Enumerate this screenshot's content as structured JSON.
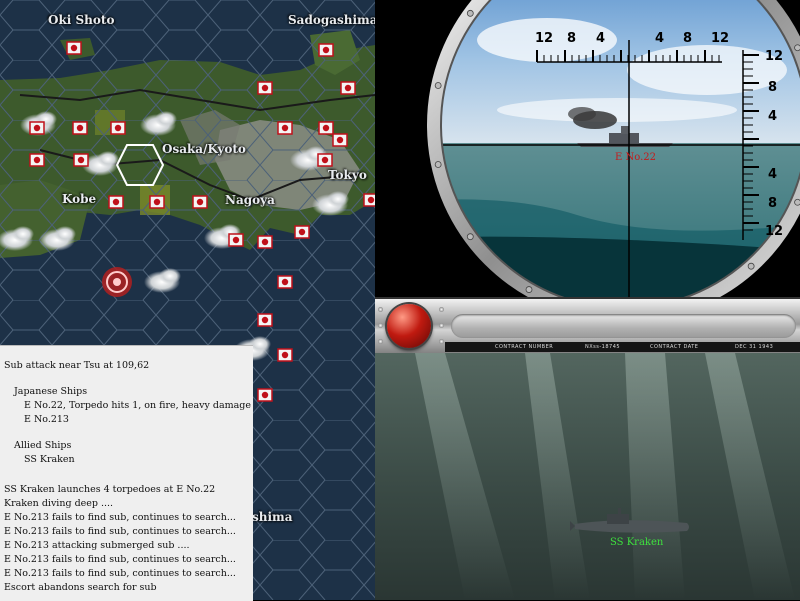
{
  "map": {
    "labels": [
      {
        "id": "oki-shoto",
        "text": "Oki Shoto"
      },
      {
        "id": "sadogashima",
        "text": "Sadogashima"
      },
      {
        "id": "osaka-kyoto",
        "text": "Osaka/Kyoto"
      },
      {
        "id": "tokyo",
        "text": "Tokyo"
      },
      {
        "id": "kobe",
        "text": "Kobe"
      },
      {
        "id": "nagoya",
        "text": "Nagoya"
      },
      {
        "id": "shima",
        "text": "shima"
      }
    ],
    "colors": {
      "sea": "#1d3147",
      "land": "#3d5a2c",
      "mountain": "#8b8e86",
      "japan_flag": "#c0101a",
      "hex_line": "#4c6178"
    }
  },
  "periscope": {
    "horizontal_scale": [
      "12",
      "8",
      "4",
      "4",
      "8",
      "12"
    ],
    "vertical_scale": [
      "12",
      "8",
      "4",
      "4",
      "8",
      "12"
    ],
    "target_label": "E No.22",
    "target_label_color": "#c41c1c"
  },
  "control_bar": {
    "contract_number_label": "CONTRACT NUMBER",
    "contract_number_value": "NXss-18745",
    "contract_date_label": "CONTRACT DATE",
    "contract_date_value": "DEC 31 1943"
  },
  "underwater": {
    "sub_label": "SS Kraken",
    "sub_label_color": "#3ee03e"
  },
  "combat_log": {
    "lines": [
      "Sub attack near Tsu  at 109,62",
      "Japanese Ships",
      "E No.22, Torpedo hits 1,  on fire,  heavy damage",
      "E No.213",
      "Allied Ships",
      "SS Kraken",
      "SS Kraken launches 4 torpedoes at E No.22",
      "Kraken diving deep ....",
      "E No.213 fails to find sub, continues to search...",
      "E No.213 fails to find sub, continues to search...",
      "E No.213 attacking submerged sub ....",
      "E No.213 fails to find sub, continues to search...",
      "E No.213 fails to find sub, continues to search...",
      "Escort abandons search for sub"
    ]
  }
}
